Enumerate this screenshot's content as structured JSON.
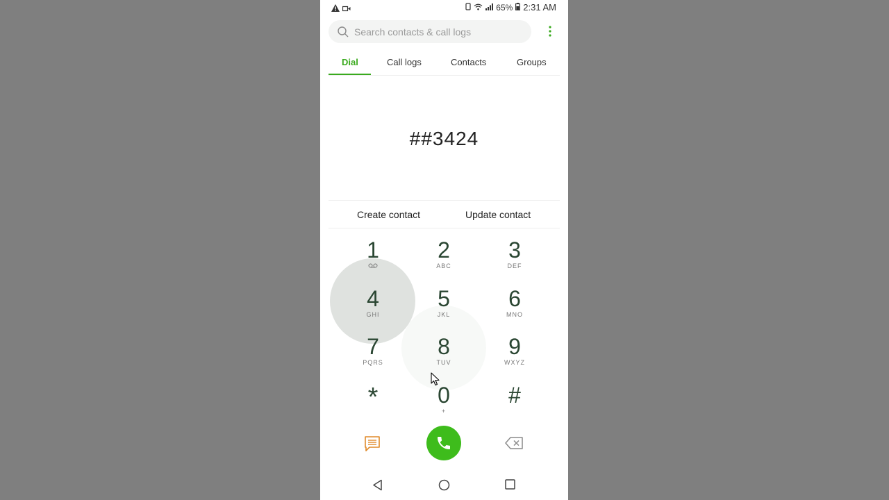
{
  "status_bar": {
    "battery": "65%",
    "time": "2:31 AM"
  },
  "search": {
    "placeholder": "Search contacts & call logs"
  },
  "tabs": [
    "Dial",
    "Call logs",
    "Contacts",
    "Groups"
  ],
  "active_tab": "Dial",
  "dialed_number": "##3424",
  "actions": {
    "create": "Create contact",
    "update": "Update contact"
  },
  "keypad": [
    {
      "digit": "1",
      "letters": ""
    },
    {
      "digit": "2",
      "letters": "ABC"
    },
    {
      "digit": "3",
      "letters": "DEF"
    },
    {
      "digit": "4",
      "letters": "GHI"
    },
    {
      "digit": "5",
      "letters": "JKL"
    },
    {
      "digit": "6",
      "letters": "MNO"
    },
    {
      "digit": "7",
      "letters": "PQRS"
    },
    {
      "digit": "8",
      "letters": "TUV"
    },
    {
      "digit": "9",
      "letters": "WXYZ"
    },
    {
      "digit": "*",
      "letters": ""
    },
    {
      "digit": "0",
      "letters": "+"
    },
    {
      "digit": "#",
      "letters": ""
    }
  ],
  "colors": {
    "accent": "#3aaa1e",
    "call_button": "#3ebc1c",
    "message_icon": "#e08a2a"
  }
}
